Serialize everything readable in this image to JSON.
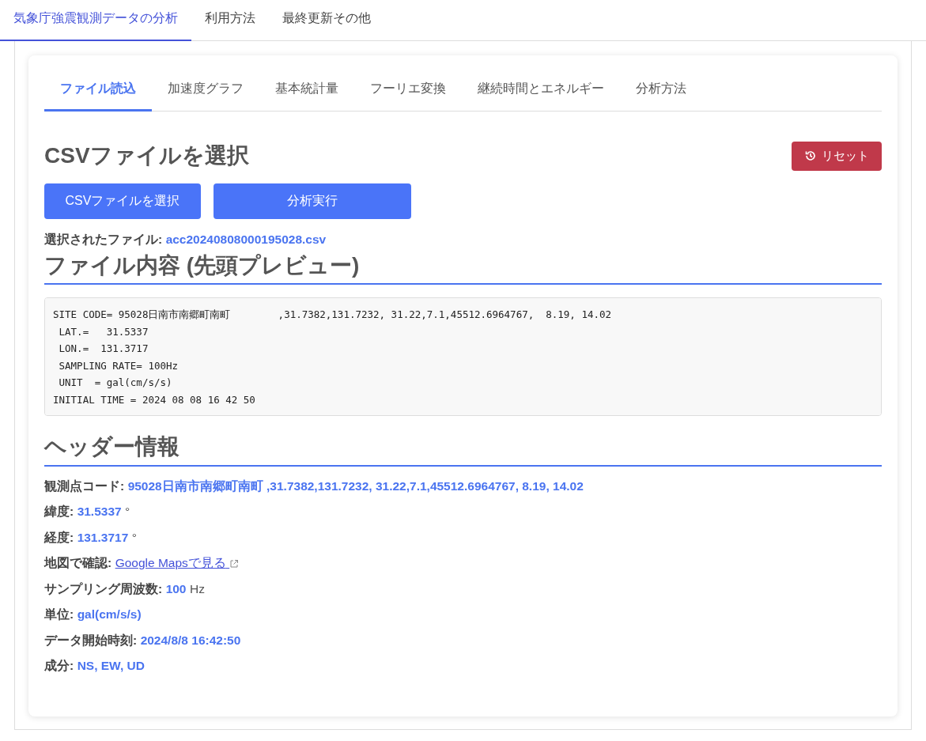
{
  "top_tabs": [
    {
      "label": "気象庁強震観測データの分析",
      "selected": true
    },
    {
      "label": "利用方法",
      "selected": false
    },
    {
      "label": "最終更新その他",
      "selected": false
    }
  ],
  "inner_tabs": [
    {
      "label": "ファイル読込",
      "selected": true
    },
    {
      "label": "加速度グラフ",
      "selected": false
    },
    {
      "label": "基本統計量",
      "selected": false
    },
    {
      "label": "フーリエ変換",
      "selected": false
    },
    {
      "label": "継続時間とエネルギー",
      "selected": false
    },
    {
      "label": "分析方法",
      "selected": false
    }
  ],
  "file_section": {
    "title": "CSVファイルを選択",
    "reset_button": "リセット",
    "select_button": "CSVファイルを選択",
    "run_button": "分析実行",
    "selected_label": "選択されたファイル:",
    "selected_file": "acc20240808000195028.csv"
  },
  "preview": {
    "title": "ファイル内容 (先頭プレビュー)",
    "lines": [
      "SITE CODE= 95028日南市南郷町南町        ,31.7382,131.7232, 31.22,7.1,45512.6964767,  8.19, 14.02",
      " LAT.=   31.5337",
      " LON.=  131.3717",
      " SAMPLING RATE= 100Hz",
      " UNIT  = gal(cm/s/s)",
      "INITIAL TIME = 2024 08 08 16 42 50"
    ]
  },
  "header_info": {
    "title": "ヘッダー情報",
    "rows": [
      {
        "kind": "value",
        "label": "観測点コード:",
        "value": "95028日南市南郷町南町 ,31.7382,131.7232, 31.22,7.1,45512.6964767, 8.19, 14.02"
      },
      {
        "kind": "value",
        "label": "緯度:",
        "value": "31.5337",
        "unit": "°"
      },
      {
        "kind": "value",
        "label": "経度:",
        "value": "131.3717",
        "unit": "°"
      },
      {
        "kind": "link",
        "label": "地図で確認:",
        "value": "Google Mapsで見る"
      },
      {
        "kind": "value",
        "label": "サンプリング周波数:",
        "value": "100",
        "unit": "Hz"
      },
      {
        "kind": "value",
        "label": "単位:",
        "value": "gal(cm/s/s)"
      },
      {
        "kind": "value",
        "label": "データ開始時刻:",
        "value": "2024/8/8 16:42:50"
      },
      {
        "kind": "value",
        "label": "成分:",
        "value": "NS, EW, UD"
      }
    ]
  }
}
